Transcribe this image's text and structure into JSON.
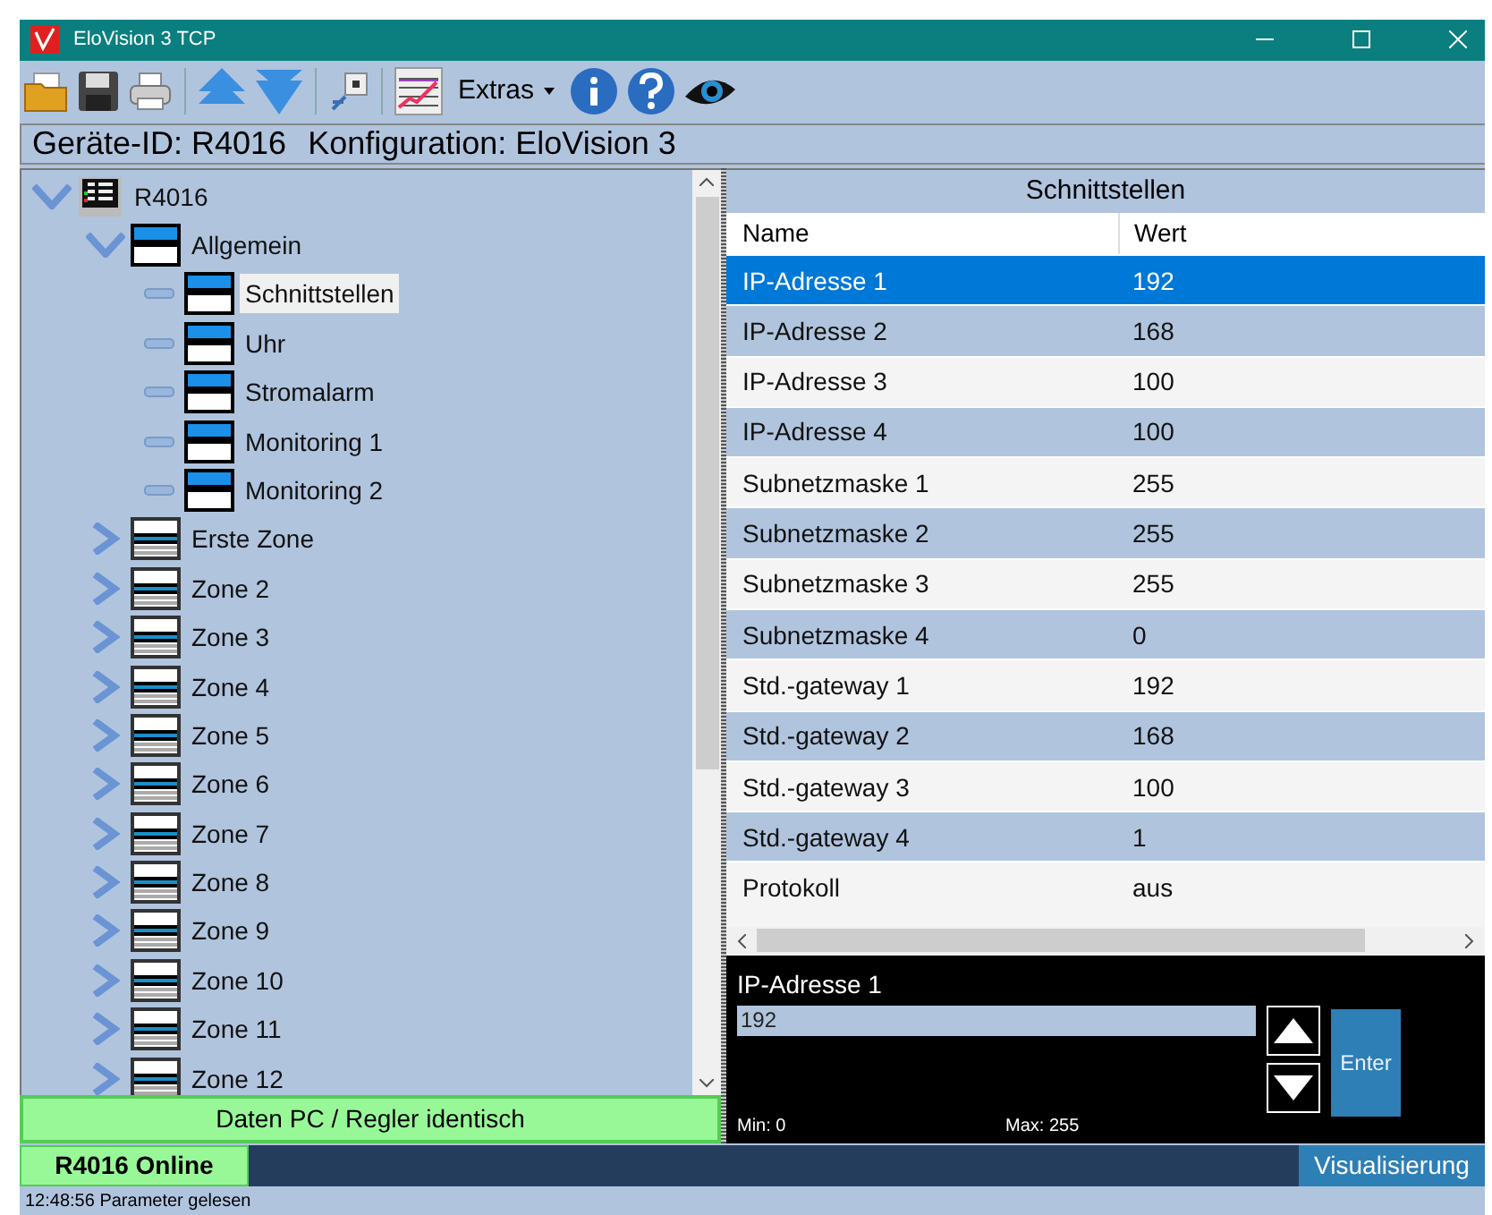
{
  "window": {
    "title": "EloVision 3 TCP"
  },
  "toolbar": {
    "extras_label": "Extras"
  },
  "header": {
    "device": "Geräte-ID: R4016",
    "configuration": "Konfiguration: EloVision 3"
  },
  "tree": [
    {
      "label": "R4016",
      "kind": "device",
      "expanded": true,
      "selected": false,
      "children": [
        {
          "label": "Allgemein",
          "kind": "group",
          "expanded": true,
          "selected": false,
          "children": [
            {
              "label": "Schnittstellen",
              "kind": "group",
              "selected": true
            },
            {
              "label": "Uhr",
              "kind": "group",
              "selected": false
            },
            {
              "label": "Stromalarm",
              "kind": "group",
              "selected": false
            },
            {
              "label": "Monitoring 1",
              "kind": "group",
              "selected": false
            },
            {
              "label": "Monitoring 2",
              "kind": "group",
              "selected": false
            }
          ]
        },
        {
          "label": "Erste Zone",
          "kind": "zone",
          "expanded": false,
          "selected": false
        },
        {
          "label": "Zone 2",
          "kind": "zone",
          "expanded": false,
          "selected": false
        },
        {
          "label": "Zone 3",
          "kind": "zone",
          "expanded": false,
          "selected": false
        },
        {
          "label": "Zone 4",
          "kind": "zone",
          "expanded": false,
          "selected": false
        },
        {
          "label": "Zone 5",
          "kind": "zone",
          "expanded": false,
          "selected": false
        },
        {
          "label": "Zone 6",
          "kind": "zone",
          "expanded": false,
          "selected": false
        },
        {
          "label": "Zone 7",
          "kind": "zone",
          "expanded": false,
          "selected": false
        },
        {
          "label": "Zone 8",
          "kind": "zone",
          "expanded": false,
          "selected": false
        },
        {
          "label": "Zone 9",
          "kind": "zone",
          "expanded": false,
          "selected": false
        },
        {
          "label": "Zone 10",
          "kind": "zone",
          "expanded": false,
          "selected": false
        },
        {
          "label": "Zone 11",
          "kind": "zone",
          "expanded": false,
          "selected": false
        },
        {
          "label": "Zone 12",
          "kind": "zone",
          "expanded": false,
          "selected": false
        }
      ]
    }
  ],
  "sync_status": "Daten PC / Regler identisch",
  "detail": {
    "title": "Schnittstellen",
    "columns": [
      "Name",
      "Wert"
    ],
    "rows": [
      {
        "name": "IP-Adresse 1",
        "value": "192",
        "selected": true
      },
      {
        "name": "IP-Adresse 2",
        "value": "168",
        "selected": false
      },
      {
        "name": "IP-Adresse 3",
        "value": "100",
        "selected": false
      },
      {
        "name": "IP-Adresse 4",
        "value": "100",
        "selected": false
      },
      {
        "name": "Subnetzmaske 1",
        "value": "255",
        "selected": false
      },
      {
        "name": "Subnetzmaske 2",
        "value": "255",
        "selected": false
      },
      {
        "name": "Subnetzmaske 3",
        "value": "255",
        "selected": false
      },
      {
        "name": "Subnetzmaske 4",
        "value": "0",
        "selected": false
      },
      {
        "name": "Std.-gateway 1",
        "value": "192",
        "selected": false
      },
      {
        "name": "Std.-gateway 2",
        "value": "168",
        "selected": false
      },
      {
        "name": "Std.-gateway 3",
        "value": "100",
        "selected": false
      },
      {
        "name": "Std.-gateway 4",
        "value": "1",
        "selected": false
      },
      {
        "name": "Protokoll",
        "value": "aus",
        "selected": false
      }
    ]
  },
  "editor": {
    "label": "IP-Adresse 1",
    "value": "192",
    "min": "Min: 0",
    "max": "Max: 255",
    "enter_label": "Enter"
  },
  "connection": "R4016 Online",
  "visualize_button": "Visualisierung",
  "status_message": "12:48:56  Parameter gelesen"
}
